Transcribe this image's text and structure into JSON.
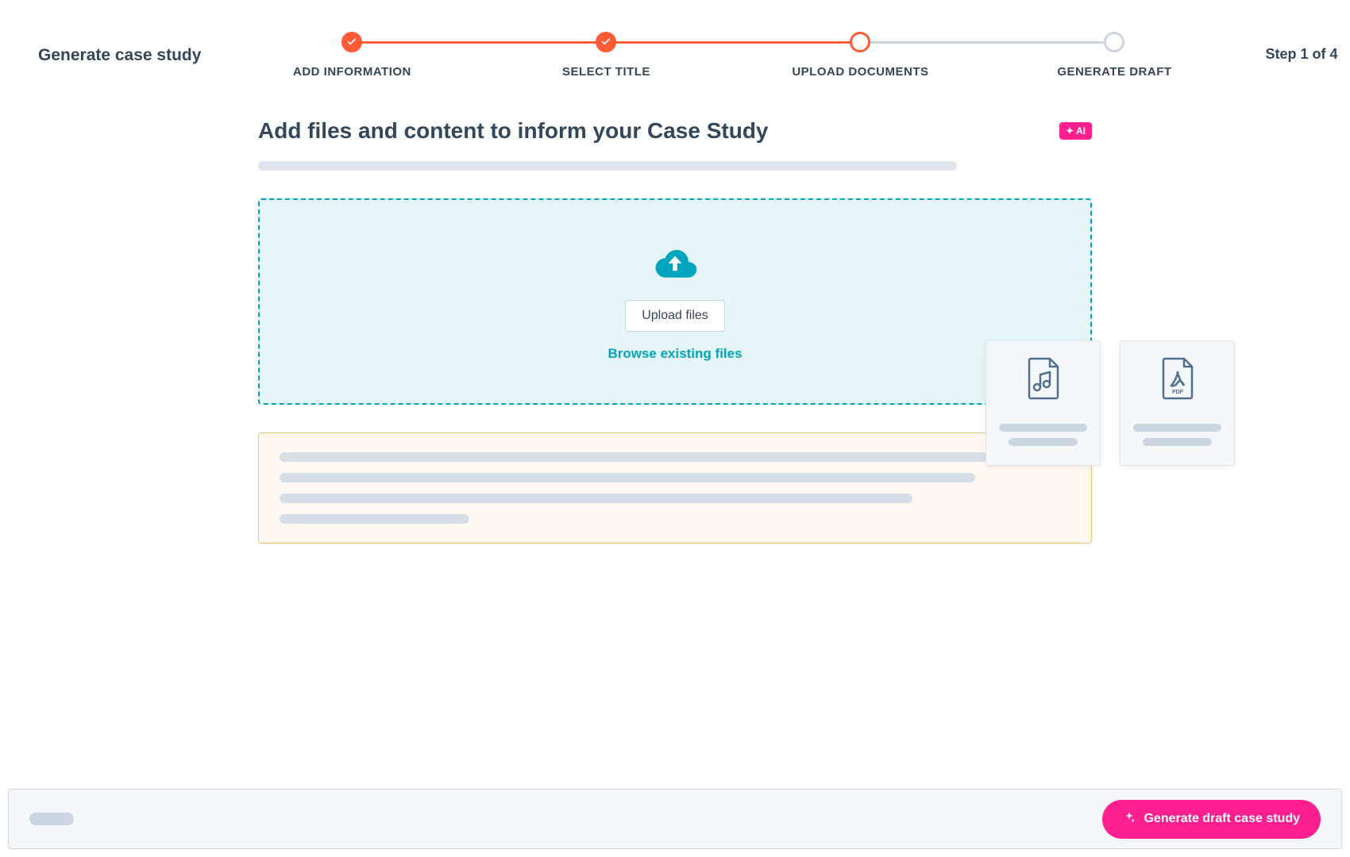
{
  "header": {
    "title": "Generate case study",
    "step_counter": "Step 1 of 4"
  },
  "stepper": {
    "steps": [
      {
        "label": "ADD INFORMATION",
        "state": "done"
      },
      {
        "label": "SELECT TITLE",
        "state": "done"
      },
      {
        "label": "UPLOAD DOCUMENTS",
        "state": "current"
      },
      {
        "label": "GENERATE DRAFT",
        "state": "future"
      }
    ]
  },
  "content": {
    "heading": "Add files and content to inform your Case Study",
    "ai_badge": "AI"
  },
  "dropzone": {
    "upload_button": "Upload files",
    "browse_link": "Browse existing files"
  },
  "file_cards": [
    {
      "type": "audio",
      "pdf_label": ""
    },
    {
      "type": "pdf",
      "pdf_label": "PDF"
    }
  ],
  "footer": {
    "primary_button": "Generate draft case study"
  },
  "colors": {
    "accent_orange": "#ff5c35",
    "accent_teal": "#00a4bd",
    "accent_pink": "#ff1f8f",
    "text": "#33475b"
  }
}
